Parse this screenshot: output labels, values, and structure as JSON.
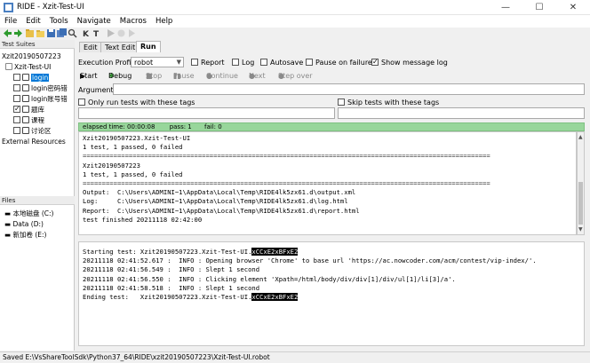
{
  "window": {
    "title": "RIDE - Xzit-Test-UI",
    "minimize": "—",
    "maximize": "☐",
    "close": "✕"
  },
  "menu": [
    "File",
    "Edit",
    "Tools",
    "Navigate",
    "Macros",
    "Help"
  ],
  "left": {
    "header": "Test Suites",
    "root": "Xzit20190507223",
    "suite": "Xzit-Test-UI",
    "items": [
      {
        "label": "login",
        "checked": false,
        "selected": true
      },
      {
        "label": "login密码错",
        "checked": false,
        "selected": false
      },
      {
        "label": "login账号错",
        "checked": false,
        "selected": false
      },
      {
        "label": "题库",
        "checked": true,
        "selected": false
      },
      {
        "label": "课程",
        "checked": false,
        "selected": false
      },
      {
        "label": "讨论区",
        "checked": false,
        "selected": false
      }
    ],
    "external": "External Resources",
    "files_header": "Files",
    "drives": [
      "本地磁盘 (C:)",
      "Data (D:)",
      "新加卷 (E:)"
    ]
  },
  "tabs": [
    "Edit",
    "Text Edit",
    "Run"
  ],
  "run": {
    "profile_label": "Execution Profile:",
    "profile_value": "robot",
    "report": "Report",
    "log": "Log",
    "autosave": "Autosave",
    "pause_on_failure": "Pause on failure",
    "show_message_log": "Show message log",
    "start": "Start",
    "debug": "Debug",
    "stop": "Stop",
    "pause": "Pause",
    "continue": "Continue",
    "next": "Next",
    "step_over": "Step over",
    "arguments_label": "Arguments:",
    "only_run_tags": "Only run tests with these tags",
    "skip_tags": "Skip tests with these tags"
  },
  "status": {
    "elapsed": "elapsed time: 00:00:08",
    "pass": "pass: 1",
    "fail": "fail: 0"
  },
  "output": [
    "Xzit20190507223.Xzit-Test-UI",
    "1 test, 1 passed, 0 failed",
    "==========================================================================================================",
    "Xzit20190507223",
    "1 test, 1 passed, 0 failed",
    "==========================================================================================================",
    "Output:  C:\\Users\\ADMINI~1\\AppData\\Local\\Temp\\RIDE4lk5zx61.d\\output.xml",
    "Log:     C:\\Users\\ADMINI~1\\AppData\\Local\\Temp\\RIDE4lk5zx61.d\\log.html",
    "Report:  C:\\Users\\ADMINI~1\\AppData\\Local\\Temp\\RIDE4lk5zx61.d\\report.html",
    "",
    "test finished 20211118 02:42:00"
  ],
  "messages": {
    "start_prefix": "Starting test: Xzit20190507223.Xzit-Test-UI.",
    "start_hl": "xCCxE2xBFxE2",
    "lines": [
      "20211118 02:41:52.617 :  INFO : Opening browser 'Chrome' to base url 'https://ac.nowcoder.com/acm/contest/vip-index/'.",
      "20211118 02:41:56.549 :  INFO : Slept 1 second",
      "20211118 02:41:56.550 :  INFO : Clicking element 'Xpath=/html/body/div/div[1]/div/ul[1]/li[3]/a'.",
      "20211118 02:41:58.518 :  INFO : Slept 1 second"
    ],
    "end_prefix": "Ending test:   Xzit20190507223.Xzit-Test-UI.",
    "end_hl": "xCCxE2xBFxE2"
  },
  "statusbar": "Saved E:\\VsShareToolSdk\\Python37_64\\RIDE\\xzit20190507223\\Xzit-Test-UI.robot",
  "colors": {
    "pass_bar": "#98d69b",
    "selection": "#0078d7"
  }
}
